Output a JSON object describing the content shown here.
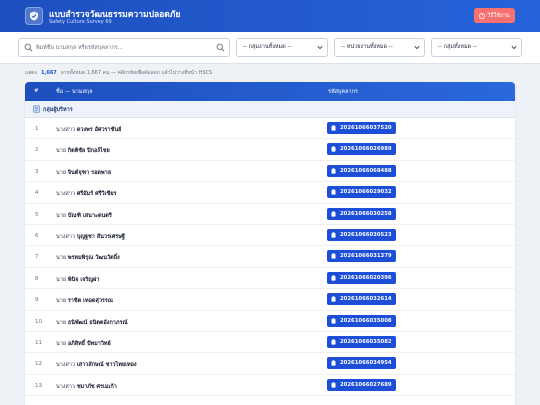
{
  "header": {
    "title": "แบบสำรวจวัฒนธรรมความปลอดภัย",
    "subtitle": "Safety Culture Survey 69",
    "help_label": "วิธีใช้งาน"
  },
  "filters": {
    "search_placeholder": "พิมพ์ชื่อ นามสกุล หรือรหัสบุคลากร...",
    "group_select": "-- กลุ่มงานทั้งหมด --",
    "unit_select": "-- หน่วยงานทั้งหมด --",
    "group2_select": "-- กลุ่มทั้งหมด --"
  },
  "summary": {
    "prefix": "แสดง",
    "count": "1,667",
    "suffix": "จากทั้งหมด 1,667 คน — คลิกรหัสเพื่อคัดลอก แล้วไปวางที่หน้า HSCS"
  },
  "table": {
    "col_no": "#",
    "col_name": "ชื่อ — นามสกุล",
    "col_code": "รหัสบุคลากร",
    "group_label": "กลุ่มผู้บริหาร",
    "rows": [
      {
        "no": "1",
        "title": "นางสาว",
        "name": "ดวงพร อัศวราชันย์",
        "code": "20261066037520"
      },
      {
        "no": "2",
        "title": "นาย",
        "name": "กิตติชัย ปิกอง์ไชย",
        "code": "20261066026989"
      },
      {
        "no": "3",
        "title": "นาย",
        "name": "จินต์จุฑา รอดพาล",
        "code": "20261066068488"
      },
      {
        "no": "4",
        "title": "นางสาว",
        "name": "ศรีอัมร์ ศรีวิเชียร",
        "code": "20261066029032"
      },
      {
        "no": "5",
        "title": "นาย",
        "name": "บัณฑิ เสนาะดนตรี",
        "code": "20261066030258"
      },
      {
        "no": "6",
        "title": "นางสาว",
        "name": "บุญฐชา สันวรเศรษฐี",
        "code": "20261066030523"
      },
      {
        "no": "7",
        "title": "นาย",
        "name": "พรหมพิรุณ วัฒนวัตถิ์ง",
        "code": "20261066031379"
      },
      {
        "no": "8",
        "title": "นาย",
        "name": "พินิจ เจริญผ่า",
        "code": "20261066020396"
      },
      {
        "no": "9",
        "title": "นาย",
        "name": "ราชิต เทอดสุวรรณ",
        "code": "20261066032614"
      },
      {
        "no": "10",
        "title": "นาย",
        "name": "ธนิพัฒน์ ธนิตตอังกาภรณ์",
        "code": "20261066035008"
      },
      {
        "no": "11",
        "title": "นาย",
        "name": "อภิสิทธิ์ ปัทมาวิทย์",
        "code": "20261066035082"
      },
      {
        "no": "12",
        "title": "นางสาว",
        "name": "เสาวลักษณ์ ชาวไทยเทอง",
        "code": "20261066034954"
      },
      {
        "no": "13",
        "title": "นางสาว",
        "name": "ชมาภัช ศรเมเก้า",
        "code": "20261066027689"
      }
    ]
  },
  "colors": {
    "primary": "#1d4ed8",
    "header": "#1e4fbf",
    "help_button": "#f87171",
    "group_bg": "#eef3fb"
  },
  "icons": [
    "shield-logo-icon",
    "question-icon",
    "search-icon",
    "chevron-down-icon",
    "group-icon",
    "clipboard-icon"
  ]
}
